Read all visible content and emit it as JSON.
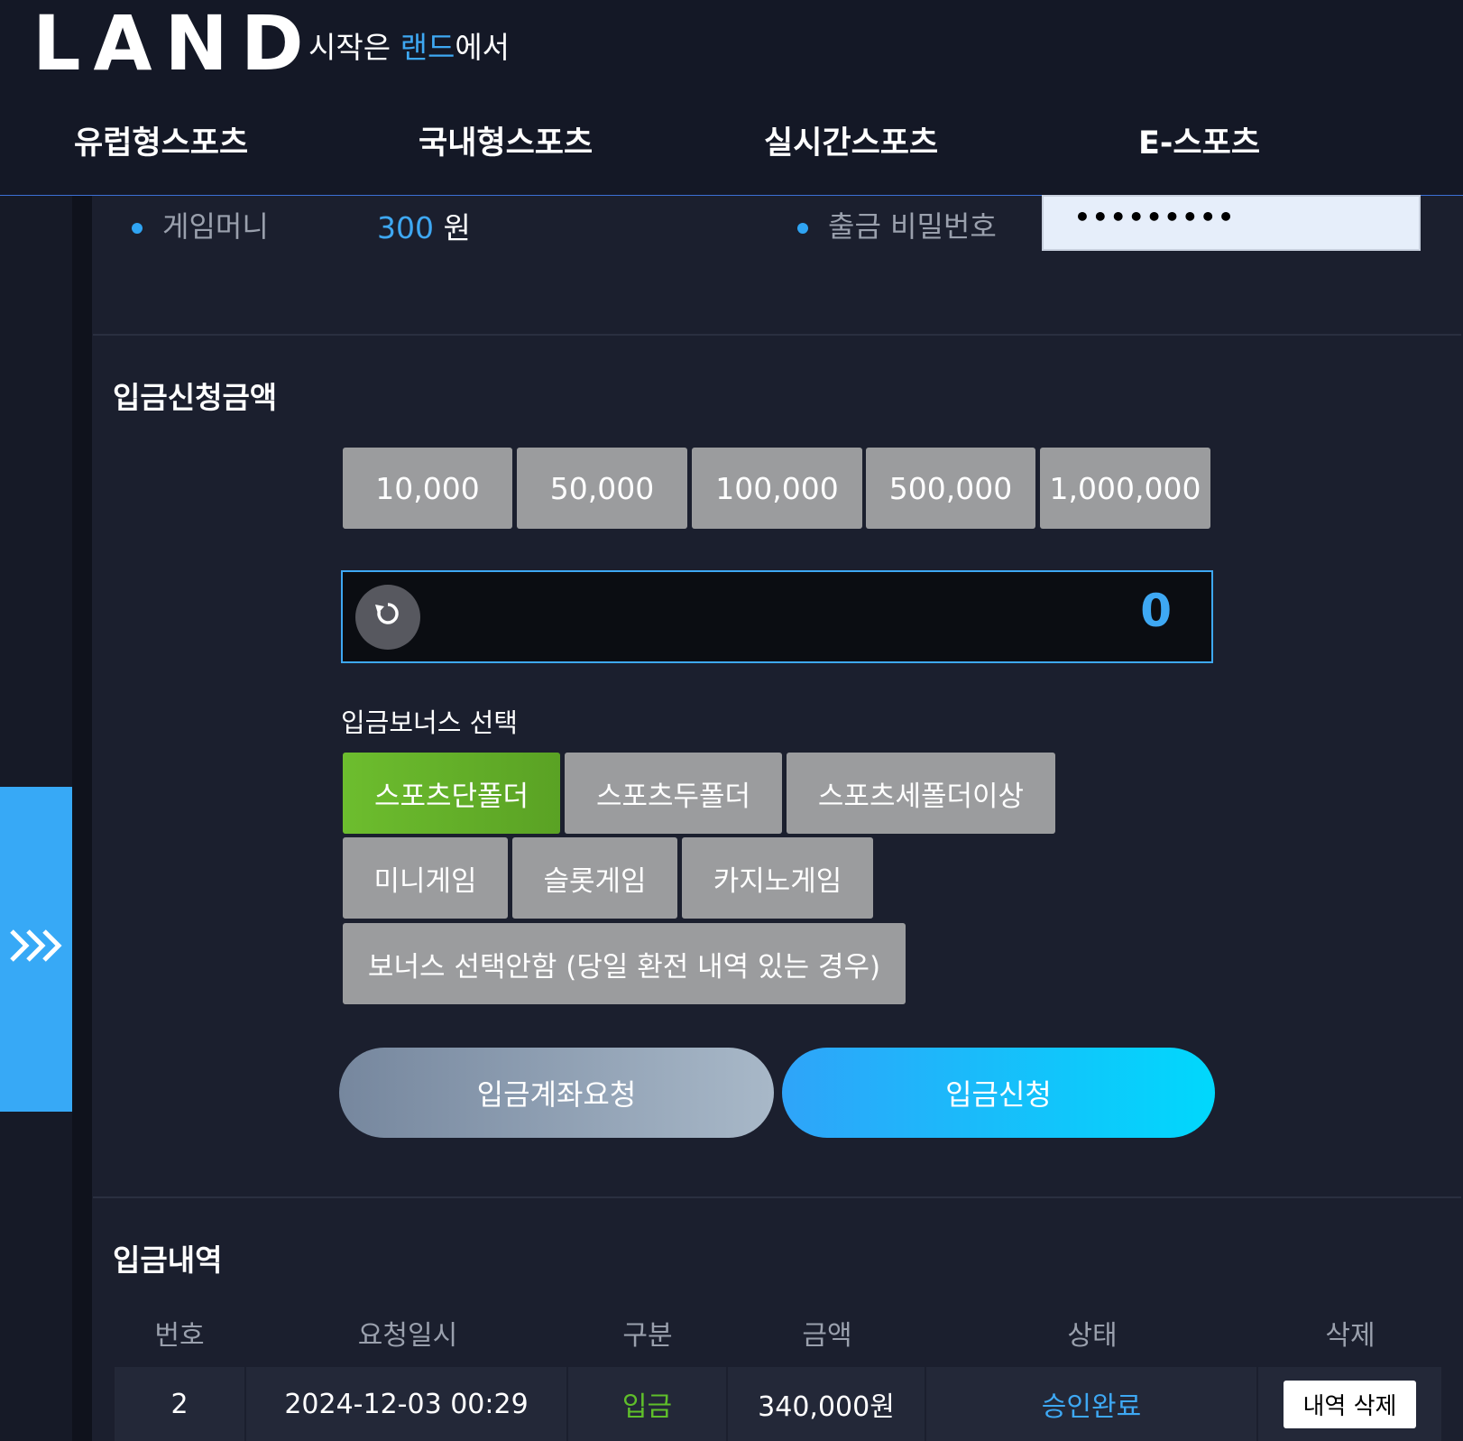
{
  "header": {
    "logo": "LAND",
    "tagline_pre": "시작은 ",
    "tagline_hl": "랜드",
    "tagline_post": "에서",
    "nav": [
      "유럽형스포츠",
      "국내형스포츠",
      "실시간스포츠",
      "E-스포츠"
    ]
  },
  "account": {
    "game_money_label": "게임머니",
    "game_money_value": "300",
    "game_money_unit": " 원",
    "withdraw_pw_label": "출금 비밀번호",
    "withdraw_pw_value": "•••••••••"
  },
  "deposit": {
    "title": "입금신청금액",
    "amounts": [
      "10,000",
      "50,000",
      "100,000",
      "500,000",
      "1,000,000"
    ],
    "amount_value": "0",
    "reset_icon": "refresh-icon",
    "bonus_label": "입금보너스 선택",
    "bonus_options": [
      "스포츠단폴더",
      "스포츠두폴더",
      "스포츠세폴더이상",
      "미니게임",
      "슬롯게임",
      "카지노게임",
      "보너스 선택안함 (당일 환전 내역 있는 경우)"
    ],
    "bonus_selected": "스포츠단폴더",
    "account_request_label": "입금계좌요청",
    "submit_label": "입금신청"
  },
  "history": {
    "title": "입금내역",
    "columns": [
      "번호",
      "요청일시",
      "구분",
      "금액",
      "상태",
      "삭제"
    ],
    "rows": [
      {
        "no": "2",
        "datetime": "2024-12-03 00:29",
        "type": "입금",
        "amount": "340,000원",
        "status": "승인완료",
        "delete_label": "내역 삭제"
      }
    ]
  },
  "colors": {
    "accent": "#3ea8f3",
    "bg": "#1b1f2e",
    "header_bg": "#141826",
    "active_bonus": "#6dbd2e"
  },
  "sidebar_toggle_icon": "triple-chevron-right-icon"
}
